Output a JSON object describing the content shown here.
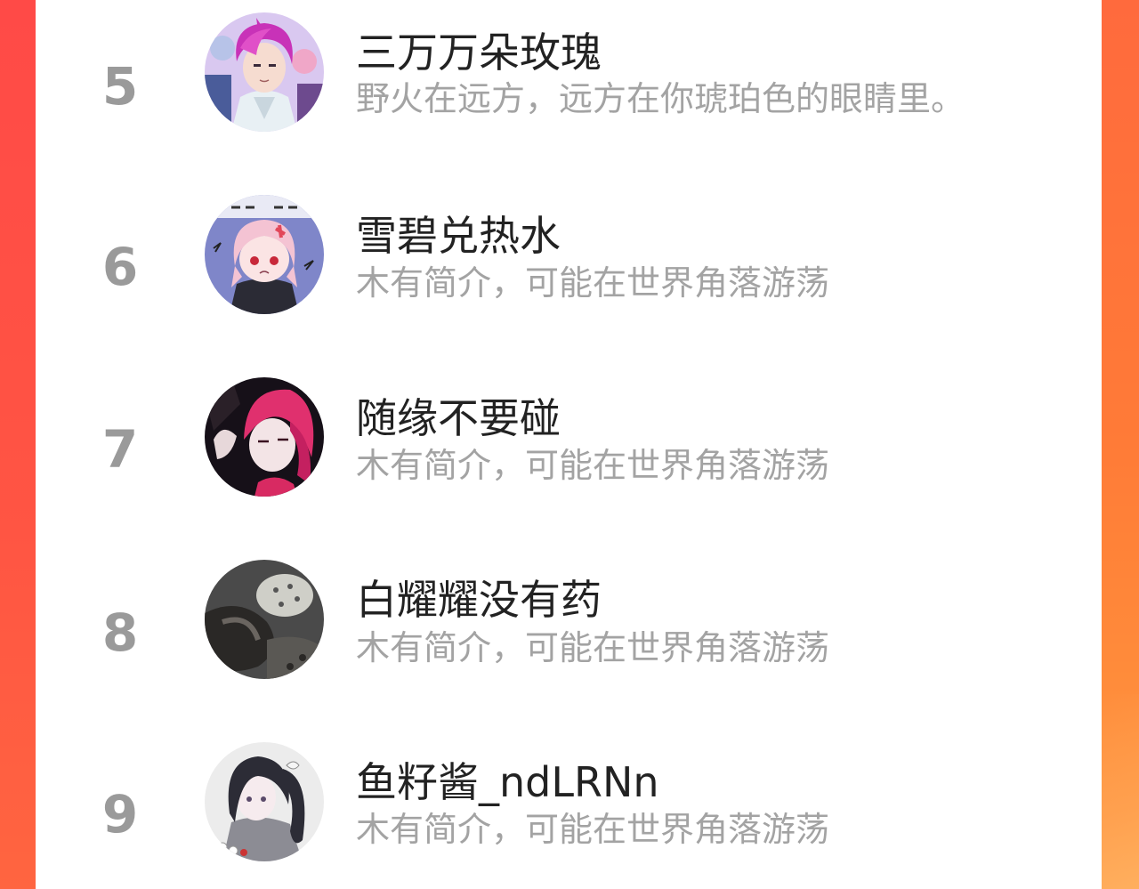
{
  "ranking": {
    "items": [
      {
        "rank": "5",
        "name": "三万万朵玫瑰",
        "bio": "野火在远方，远方在你琥珀色的眼睛里。",
        "avatar_icon": "anime-boy-purple-hair-avatar"
      },
      {
        "rank": "6",
        "name": "雪碧兑热水",
        "bio": "木有简介，可能在世界角落游荡",
        "avatar_icon": "anime-girl-pink-hair-avatar"
      },
      {
        "rank": "7",
        "name": "随缘不要碰",
        "bio": "木有简介，可能在世界角落游荡",
        "avatar_icon": "anime-red-hair-avatar"
      },
      {
        "rank": "8",
        "name": "白耀耀没有药",
        "bio": "木有简介，可能在世界角落游荡",
        "avatar_icon": "snow-leopard-avatar"
      },
      {
        "rank": "9",
        "name": "鱼籽酱_ndLRNn",
        "bio": "木有简介，可能在世界角落游荡",
        "avatar_icon": "anime-girl-dark-hair-avatar"
      }
    ]
  },
  "colors": {
    "background_accent": "#ff5a40",
    "rank_text": "#9a9a9a",
    "name_text": "#222222",
    "bio_text": "#a3a3a3"
  }
}
